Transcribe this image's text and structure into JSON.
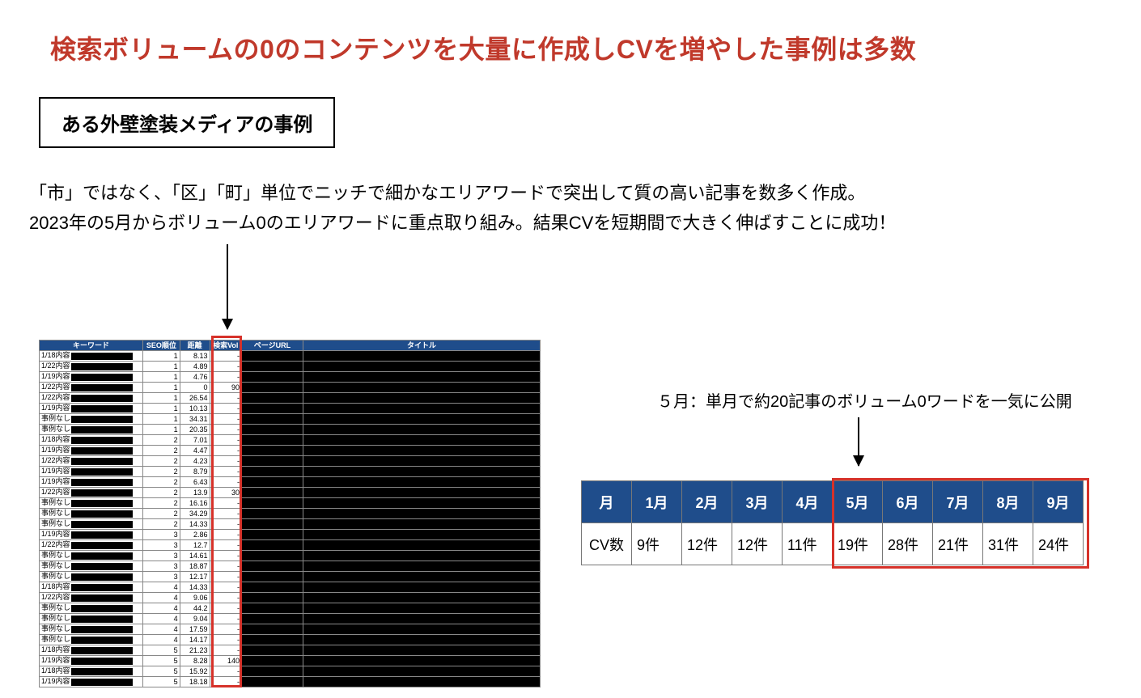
{
  "title": "検索ボリュームの0のコンテンツを大量に作成しCVを増やした事例は多数",
  "box_label": "ある外壁塗装メディアの事例",
  "body_line1": "「市」ではなく、「区」「町」単位でニッチで細かなエリアワードで突出して質の高い記事を数多く作成。",
  "body_line2": "2023年の5月からボリューム0のエリアワードに重点取り組み。結果CVを短期間で大きく伸ばすことに成功！",
  "sheet": {
    "headers": [
      "キーワード",
      "SEO順位",
      "距離",
      "検索Vol",
      "ページURL",
      "タイトル"
    ],
    "rows": [
      {
        "date": "1/18内容",
        "rank": "1",
        "dist": "8.13",
        "vol": "-"
      },
      {
        "date": "1/22内容",
        "rank": "1",
        "dist": "4.89",
        "vol": "-"
      },
      {
        "date": "1/19内容",
        "rank": "1",
        "dist": "4.76",
        "vol": "-"
      },
      {
        "date": "1/22内容",
        "rank": "1",
        "dist": "0",
        "vol": "90"
      },
      {
        "date": "1/22内容",
        "rank": "1",
        "dist": "26.54",
        "vol": "-"
      },
      {
        "date": "1/19内容",
        "rank": "1",
        "dist": "10.13",
        "vol": "-"
      },
      {
        "date": "事例なし",
        "rank": "1",
        "dist": "34.31",
        "vol": "-"
      },
      {
        "date": "事例なし",
        "rank": "1",
        "dist": "20.35",
        "vol": "-"
      },
      {
        "date": "1/18内容",
        "rank": "2",
        "dist": "7.01",
        "vol": "-"
      },
      {
        "date": "1/19内容",
        "rank": "2",
        "dist": "4.47",
        "vol": "-"
      },
      {
        "date": "1/22内容",
        "rank": "2",
        "dist": "4.23",
        "vol": "-"
      },
      {
        "date": "1/19内容",
        "rank": "2",
        "dist": "8.79",
        "vol": "-"
      },
      {
        "date": "1/19内容",
        "rank": "2",
        "dist": "6.43",
        "vol": "-"
      },
      {
        "date": "1/22内容",
        "rank": "2",
        "dist": "13.9",
        "vol": "30"
      },
      {
        "date": "事例なし",
        "rank": "2",
        "dist": "16.16",
        "vol": "-"
      },
      {
        "date": "事例なし",
        "rank": "2",
        "dist": "34.29",
        "vol": "-"
      },
      {
        "date": "事例なし",
        "rank": "2",
        "dist": "14.33",
        "vol": "-"
      },
      {
        "date": "1/19内容",
        "rank": "3",
        "dist": "2.86",
        "vol": "-"
      },
      {
        "date": "1/22内容",
        "rank": "3",
        "dist": "12.7",
        "vol": "-"
      },
      {
        "date": "事例なし",
        "rank": "3",
        "dist": "14.61",
        "vol": "-"
      },
      {
        "date": "事例なし",
        "rank": "3",
        "dist": "18.87",
        "vol": "-"
      },
      {
        "date": "事例なし",
        "rank": "3",
        "dist": "12.17",
        "vol": "-"
      },
      {
        "date": "1/18内容",
        "rank": "4",
        "dist": "14.33",
        "vol": "-"
      },
      {
        "date": "1/22内容",
        "rank": "4",
        "dist": "9.06",
        "vol": "-"
      },
      {
        "date": "事例なし",
        "rank": "4",
        "dist": "44.2",
        "vol": "-"
      },
      {
        "date": "事例なし",
        "rank": "4",
        "dist": "9.04",
        "vol": "-"
      },
      {
        "date": "事例なし",
        "rank": "4",
        "dist": "17.59",
        "vol": "-"
      },
      {
        "date": "事例なし",
        "rank": "4",
        "dist": "14.17",
        "vol": "-"
      },
      {
        "date": "1/18内容",
        "rank": "5",
        "dist": "21.23",
        "vol": "-"
      },
      {
        "date": "1/19内容",
        "rank": "5",
        "dist": "8.28",
        "vol": "140"
      },
      {
        "date": "1/18内容",
        "rank": "5",
        "dist": "15.92",
        "vol": "-"
      },
      {
        "date": "1/19内容",
        "rank": "5",
        "dist": "18.18",
        "vol": "-"
      }
    ]
  },
  "right_note": "５月：単月で約20記事のボリューム0ワードを一気に公開",
  "chart_data": {
    "type": "table",
    "title": "月別CV数",
    "row_header": "月",
    "data_row_header": "CV数",
    "categories": [
      "1月",
      "2月",
      "3月",
      "4月",
      "5月",
      "6月",
      "7月",
      "8月",
      "9月"
    ],
    "values": [
      "9件",
      "12件",
      "12件",
      "11件",
      "19件",
      "28件",
      "21件",
      "31件",
      "24件"
    ],
    "highlight_start_index": 4
  }
}
